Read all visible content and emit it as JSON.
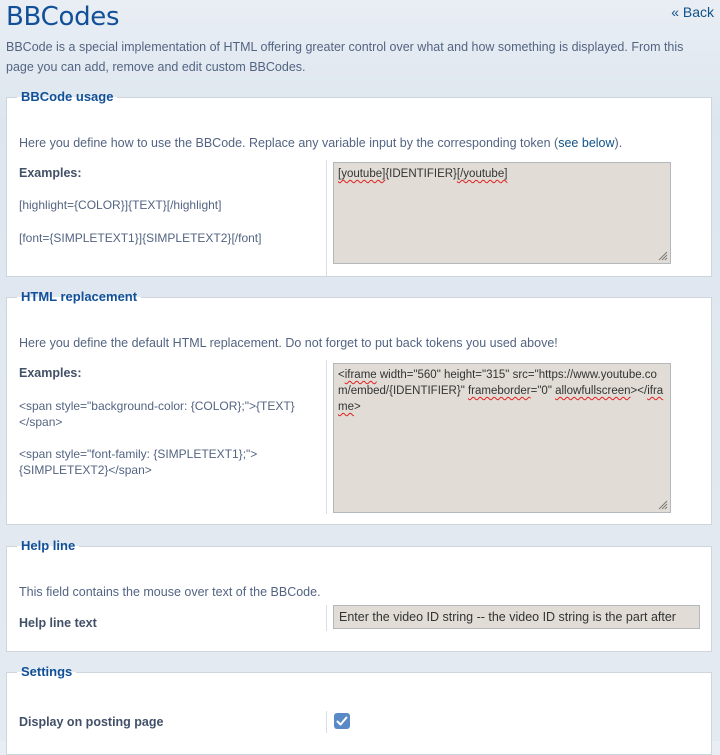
{
  "header": {
    "title": "BBCodes",
    "back_label": "« Back",
    "intro": "BBCode is a special implementation of HTML offering greater control over what and how something is displayed. From this page you can add, remove and edit custom BBCodes."
  },
  "usage": {
    "legend": "BBCode usage",
    "desc_prefix": "Here you define how to use the BBCode. Replace any variable input by the corresponding token (",
    "desc_link": "see below",
    "desc_suffix": ").",
    "examples_label": "Examples:",
    "examples": [
      "[highlight={COLOR}]{TEXT}[/highlight]",
      "[font={SIMPLETEXT1}]{SIMPLETEXT2}[/font]"
    ],
    "value_parts": [
      "[youtube]",
      "{IDENTIFIER}",
      "[/youtube]"
    ]
  },
  "html": {
    "legend": "HTML replacement",
    "desc": "Here you define the default HTML replacement. Do not forget to put back tokens you used above!",
    "examples_label": "Examples:",
    "examples": [
      "<span style=\"background-color: {COLOR};\">{TEXT}</span>",
      "<span style=\"font-family: {SIMPLETEXT1};\">{SIMPLETEXT2}</span>"
    ],
    "value_parts": [
      "<",
      "iframe",
      " width=\"560\" height=\"315\" src=\"https://www.youtube.com/embed/{IDENTIFIER}\" ",
      "frameborder",
      "=\"0\" ",
      "allowfullscreen",
      "></",
      "iframe",
      ">"
    ]
  },
  "help": {
    "legend": "Help line",
    "desc": "This field contains the mouse over text of the BBCode.",
    "field_label": "Help line text",
    "value": "Enter the video ID string -- the video ID string is the part after"
  },
  "settings": {
    "legend": "Settings",
    "display_label": "Display on posting page",
    "display_checked": true
  },
  "colors": {
    "title": "#115098",
    "text": "#536482",
    "textarea_bg": "#e1ddd6",
    "checkbox": "#5a8ac6"
  }
}
